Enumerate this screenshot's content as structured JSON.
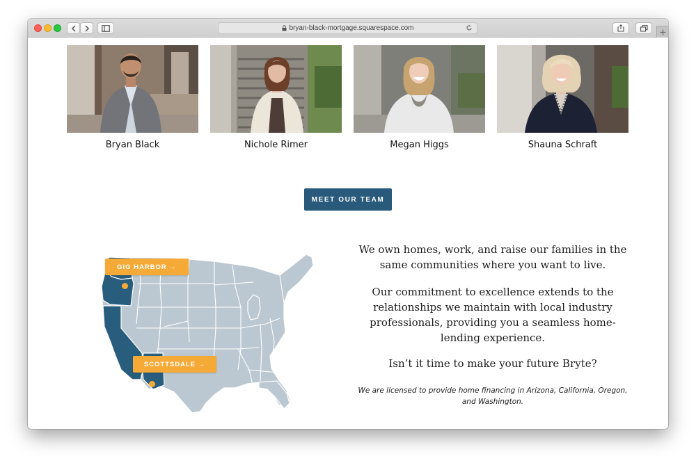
{
  "browser": {
    "url": "bryan-black-mortgage.squarespace.com"
  },
  "team": {
    "members": [
      {
        "name": "Bryan Black"
      },
      {
        "name": "Nichole Rimer"
      },
      {
        "name": "Megan Higgs"
      },
      {
        "name": "Shauna Schraft"
      }
    ],
    "cta_label": "MEET OUR TEAM"
  },
  "map": {
    "locations": [
      {
        "label": "GIG HARBOR →"
      },
      {
        "label": "SCOTTSDALE →"
      }
    ],
    "colors": {
      "licensed_state": "#285d7e",
      "other_state": "#bcc8d1",
      "border": "#ffffff",
      "marker": "#f5a936"
    }
  },
  "about": {
    "paragraph_1": "We own homes, work, and raise our families in the same communities where you want to live.",
    "paragraph_2": "Our commitment to excellence extends to the relationships we maintain with local industry professionals, providing you a seamless home-lending experience.",
    "paragraph_3": "Isn’t it time to make your future Bryte?",
    "disclaimer": "We are licensed to provide home financing in Arizona, California, Oregon, and Washington."
  },
  "theme": {
    "accent": "#2a5a7b",
    "highlight": "#f5a936"
  }
}
